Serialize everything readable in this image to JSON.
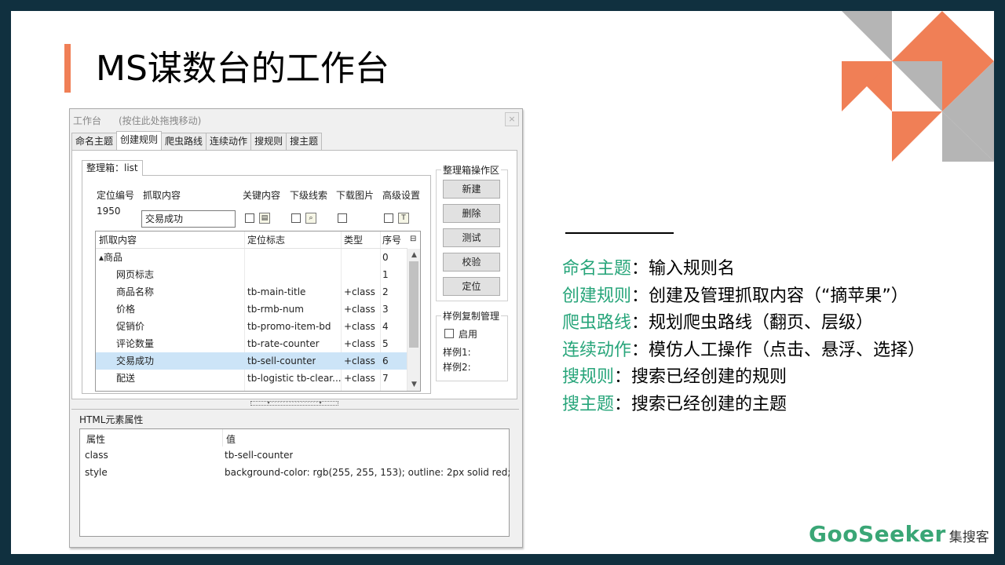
{
  "slide": {
    "title": "MS谋数台的工作台",
    "colors": {
      "accent": "#f07f56",
      "deco_gray": "#b5b5b5",
      "key_green": "#27a57a",
      "frame": "#10303f"
    }
  },
  "window": {
    "title": "工作台",
    "drag_hint": "(按住此处拖拽移动)",
    "close_label": "×",
    "tabs": [
      "命名主题",
      "创建规则",
      "爬虫路线",
      "连续动作",
      "搜规则",
      "搜主题"
    ],
    "active_tab": "创建规则",
    "box_tab": "整理箱：list",
    "form": {
      "pos_id_label": "定位编号",
      "pos_id_value": "1950",
      "capture_label": "抓取内容",
      "capture_value": "交易成功",
      "keyword_label": "关键内容",
      "sublink_label": "下级线索",
      "download_label": "下载图片",
      "advanced_label": "高级设置"
    },
    "grid": {
      "headers": [
        "抓取内容",
        "定位标志",
        "类型",
        "序号"
      ],
      "rows": [
        {
          "name": "▴商品",
          "locator": "",
          "type": "",
          "index": "0"
        },
        {
          "name": "网页标志",
          "locator": "",
          "type": "",
          "index": "1"
        },
        {
          "name": "商品名称",
          "locator": "tb-main-title",
          "type": "+class",
          "index": "2"
        },
        {
          "name": "价格",
          "locator": "tb-rmb-num",
          "type": "+class",
          "index": "3"
        },
        {
          "name": "促销价",
          "locator": "tb-promo-item-bd",
          "type": "+class",
          "index": "4"
        },
        {
          "name": "评论数量",
          "locator": "tb-rate-counter",
          "type": "+class",
          "index": "5"
        },
        {
          "name": "交易成功",
          "locator": "tb-sell-counter",
          "type": "+class",
          "index": "6"
        },
        {
          "name": "配送",
          "locator": "tb-logistic tb-clear...",
          "type": "+class",
          "index": "7"
        }
      ]
    },
    "box_ops": {
      "legend": "整理箱操作区",
      "buttons": [
        "新建",
        "删除",
        "测试",
        "校验",
        "定位"
      ]
    },
    "sample_copy": {
      "legend": "样例复制管理",
      "enable_label": "启用",
      "sample1": "样例1:",
      "sample2": "样例2:"
    },
    "html_attrs": {
      "title": "HTML元素属性",
      "headers": [
        "属性",
        "值"
      ],
      "rows": [
        {
          "attr": "class",
          "value": "tb-sell-counter"
        },
        {
          "attr": "style",
          "value": "background-color: rgb(255, 255, 153); outline: 2px solid red;"
        }
      ]
    }
  },
  "descriptions": [
    {
      "key": "命名主题",
      "text": "：输入规则名"
    },
    {
      "key": "创建规则",
      "text": "：创建及管理抓取内容（“摘苹果”）"
    },
    {
      "key": "爬虫路线",
      "text": "：规划爬虫路线（翻页、层级）"
    },
    {
      "key": "连续动作",
      "text": "：模仿人工操作（点击、悬浮、选择）"
    },
    {
      "key": "搜规则",
      "text": "：搜索已经创建的规则"
    },
    {
      "key": "搜主题",
      "text": "：搜索已经创建的主题"
    }
  ],
  "logo": {
    "brand": "GooSeeker",
    "brand_cn": "集搜客"
  }
}
